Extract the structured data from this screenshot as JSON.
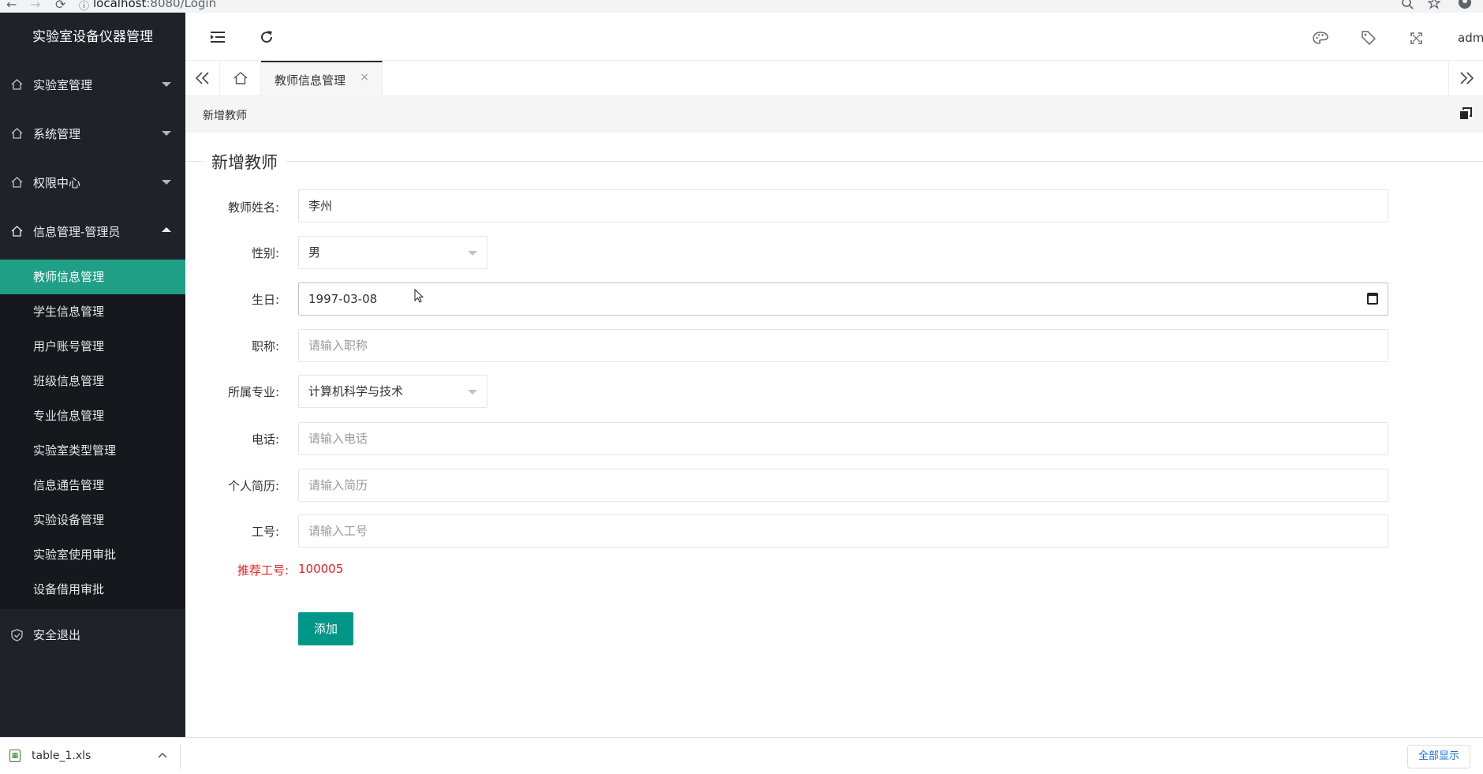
{
  "browser": {
    "url_host": "localhost",
    "url_rest": ":8080/Login",
    "back_icon": "←",
    "forward_icon": "→",
    "reload_icon": "⟳",
    "info_icon": "ⓘ"
  },
  "sidebar": {
    "logo": "实验室设备仪器管理",
    "menus": [
      {
        "label": "实验室管理",
        "icon": "home-icon",
        "expanded": false
      },
      {
        "label": "系统管理",
        "icon": "home-icon",
        "expanded": false
      },
      {
        "label": "权限中心",
        "icon": "home-icon",
        "expanded": false
      },
      {
        "label": "信息管理-管理员",
        "icon": "home-icon",
        "expanded": true
      }
    ],
    "submenu": [
      {
        "label": "教师信息管理",
        "active": true
      },
      {
        "label": "学生信息管理"
      },
      {
        "label": "用户账号管理"
      },
      {
        "label": "班级信息管理"
      },
      {
        "label": "专业信息管理"
      },
      {
        "label": "实验室类型管理"
      },
      {
        "label": "信息通告管理"
      },
      {
        "label": "实验设备管理"
      },
      {
        "label": "实验室使用审批"
      },
      {
        "label": "设备借用审批"
      }
    ],
    "logout": "安全退出"
  },
  "header": {
    "user": "adm"
  },
  "tabs": {
    "active_label": "教师信息管理",
    "close_glyph": "×"
  },
  "crumb": {
    "title": "新增教师"
  },
  "form": {
    "legend": "新增教师",
    "fields": {
      "name": {
        "label": "教师姓名:",
        "value": "李州"
      },
      "gender": {
        "label": "性别:",
        "value": "男"
      },
      "birthday": {
        "label": "生日:",
        "value": "1997-03-08"
      },
      "title": {
        "label": "职称:",
        "placeholder": "请输入职称"
      },
      "major": {
        "label": "所属专业:",
        "value": "计算机科学与技术"
      },
      "phone": {
        "label": "电话:",
        "placeholder": "请输入电话"
      },
      "resume": {
        "label": "个人简历:",
        "placeholder": "请输入简历"
      },
      "job_no": {
        "label": "工号:",
        "placeholder": "请输入工号"
      }
    },
    "hint_label": "推荐工号:",
    "hint_value": "100005",
    "submit": "添加"
  },
  "downloads": {
    "file": "table_1.xls",
    "show_all": "全部显示"
  },
  "colors": {
    "sidebar_bg": "#20222a",
    "submenu_bg": "#16181d",
    "accent": "#009688",
    "hint": "#e02020"
  }
}
